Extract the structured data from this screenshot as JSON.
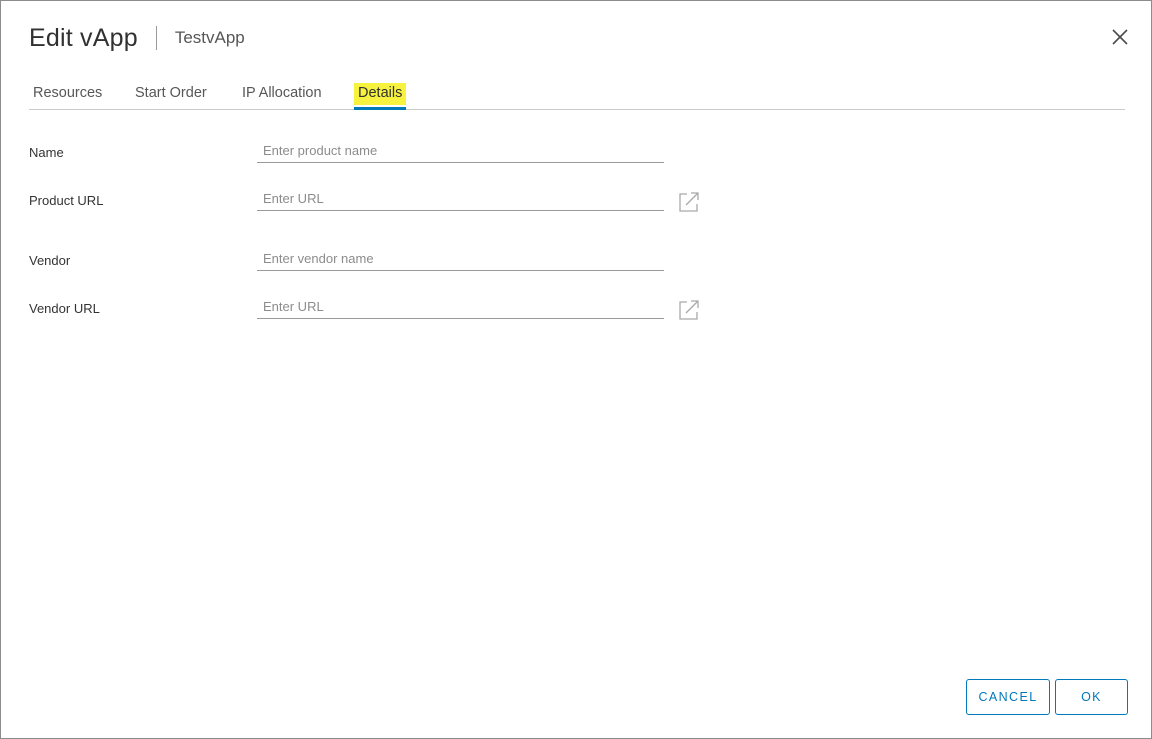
{
  "dialog": {
    "title": "Edit vApp",
    "subtitle": "TestvApp"
  },
  "tabs": [
    {
      "label": "Resources",
      "active": false
    },
    {
      "label": "Start Order",
      "active": false
    },
    {
      "label": "IP Allocation",
      "active": false
    },
    {
      "label": "Details",
      "active": true
    }
  ],
  "form": {
    "name": {
      "label": "Name",
      "value": "",
      "placeholder": "Enter product name"
    },
    "product_url": {
      "label": "Product URL",
      "value": "",
      "placeholder": "Enter URL"
    },
    "vendor": {
      "label": "Vendor",
      "value": "",
      "placeholder": "Enter vendor name"
    },
    "vendor_url": {
      "label": "Vendor URL",
      "value": "",
      "placeholder": "Enter URL"
    }
  },
  "footer": {
    "cancel_label": "CANCEL",
    "ok_label": "OK"
  },
  "icons": {
    "close": "close-icon",
    "open_link": "external-link-icon"
  },
  "colors": {
    "accent": "#0079b8",
    "tab_highlight": "#f7f23d"
  }
}
